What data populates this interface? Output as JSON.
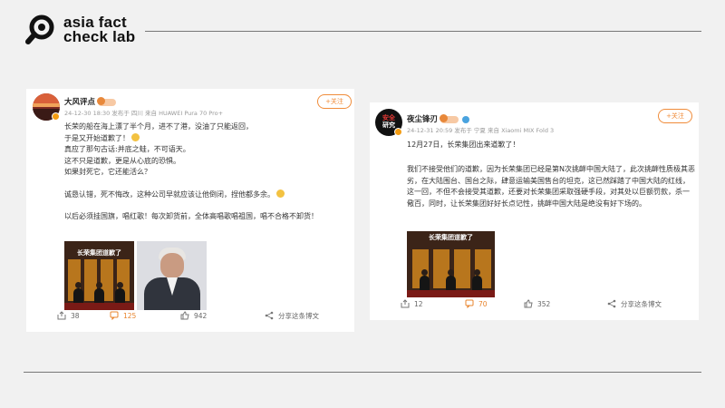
{
  "brand": {
    "line1": "asia fact",
    "line2": "check lab"
  },
  "posts": [
    {
      "username": "大风评点",
      "meta": "24-12-30 18:30 发布于 四川 来自 HUAWEI Pura 70 Pro+",
      "follow_label": "+关注",
      "lines": [
        "长荣的船在海上漂了半个月，进不了港，没油了只能返回，",
        "于是又开始道歉了！",
        "真应了那句古话:并底之蛙，不可语天。",
        "这不只是道歉，更是从心底的恐惧。",
        "如果封死它，它还能活么？",
        "",
        "诚恳认错，死不悔改，这种公司早就应该让他倒闭，捏他都多余。",
        "",
        "以后必须挂国旗，唱红歌！每次卸货前，全体高唱歌唱祖国，唱不合格不卸货！"
      ],
      "image_banner": "长荣集团道歉了",
      "actions": {
        "share": "38",
        "comment": "125",
        "like": "942",
        "share_note": "分享这条博文"
      }
    },
    {
      "username": "夜尘锋刃",
      "avatar_text_top": "安全",
      "avatar_text_bottom": "研究",
      "meta": "24-12-31 20:59 发布于 宁夏 来自 Xiaomi MIX Fold 3",
      "follow_label": "+关注",
      "headline": "12月27日，长荣集团出来道歉了！",
      "paragraph": "我们不接受他们的道歉，因为长荣集团已经是第N次挑衅中国大陆了，此次挑衅性质极其恶劣，在大陆围台、国台之际，肆意运输美国售台的坦克，这已然踩踏了中国大陆的红线，这一回，不但不会接受其道歉，还要对长荣集团采取强硬手段，对其处以巨额罚款，杀一儆百，同时，让长荣集团好好长点记性，挑衅中国大陆是绝没有好下场的。",
      "image_banner": "长荣集团道歉了",
      "actions": {
        "share": "12",
        "comment": "70",
        "like": "352",
        "share_note": "分享这条博文"
      }
    }
  ],
  "colors": {
    "accent": "#f08c3a",
    "logo": "#111111",
    "page_bg": "#f1f1f1"
  }
}
